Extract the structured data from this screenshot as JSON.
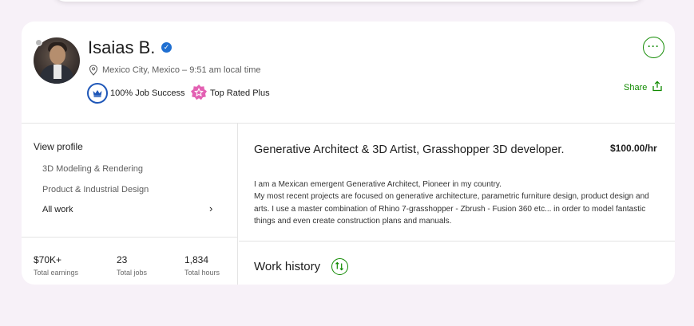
{
  "profile": {
    "name": "Isaias B.",
    "location": "Mexico City, Mexico – 9:51 am local time",
    "badges": [
      {
        "label": "100% Job Success",
        "icon": "crown-icon"
      },
      {
        "label": "Top Rated Plus",
        "icon": "star-badge-icon"
      }
    ],
    "share_label": "Share",
    "more_label": "···"
  },
  "sidebar": {
    "heading": "View profile",
    "items": [
      "3D Modeling & Rendering",
      "Product & Industrial Design"
    ],
    "all_work": "All work",
    "chevron": "›"
  },
  "stats": [
    {
      "value": "$70K+",
      "label": "Total earnings"
    },
    {
      "value": "23",
      "label": "Total jobs"
    },
    {
      "value": "1,834",
      "label": "Total hours"
    }
  ],
  "main": {
    "title": "Generative Architect & 3D Artist, Grasshopper 3D developer.",
    "rate": "$100.00/hr",
    "description_1": "I am a Mexican emergent Generative Architect, Pioneer in my country.",
    "description_2": "My most recent projects are focused on generative architecture, parametric furniture design, product design and arts. I use a master combination of Rhino 7-grasshopper - Zbrush - Fusion 360 etc... in order to model fantastic things and even create construction plans and manuals.",
    "work_history": "Work history"
  },
  "colors": {
    "accent": "#108a00",
    "verified": "#1f6fd1",
    "top_rated": "#e361b3",
    "job_success": "#1f57b8"
  }
}
